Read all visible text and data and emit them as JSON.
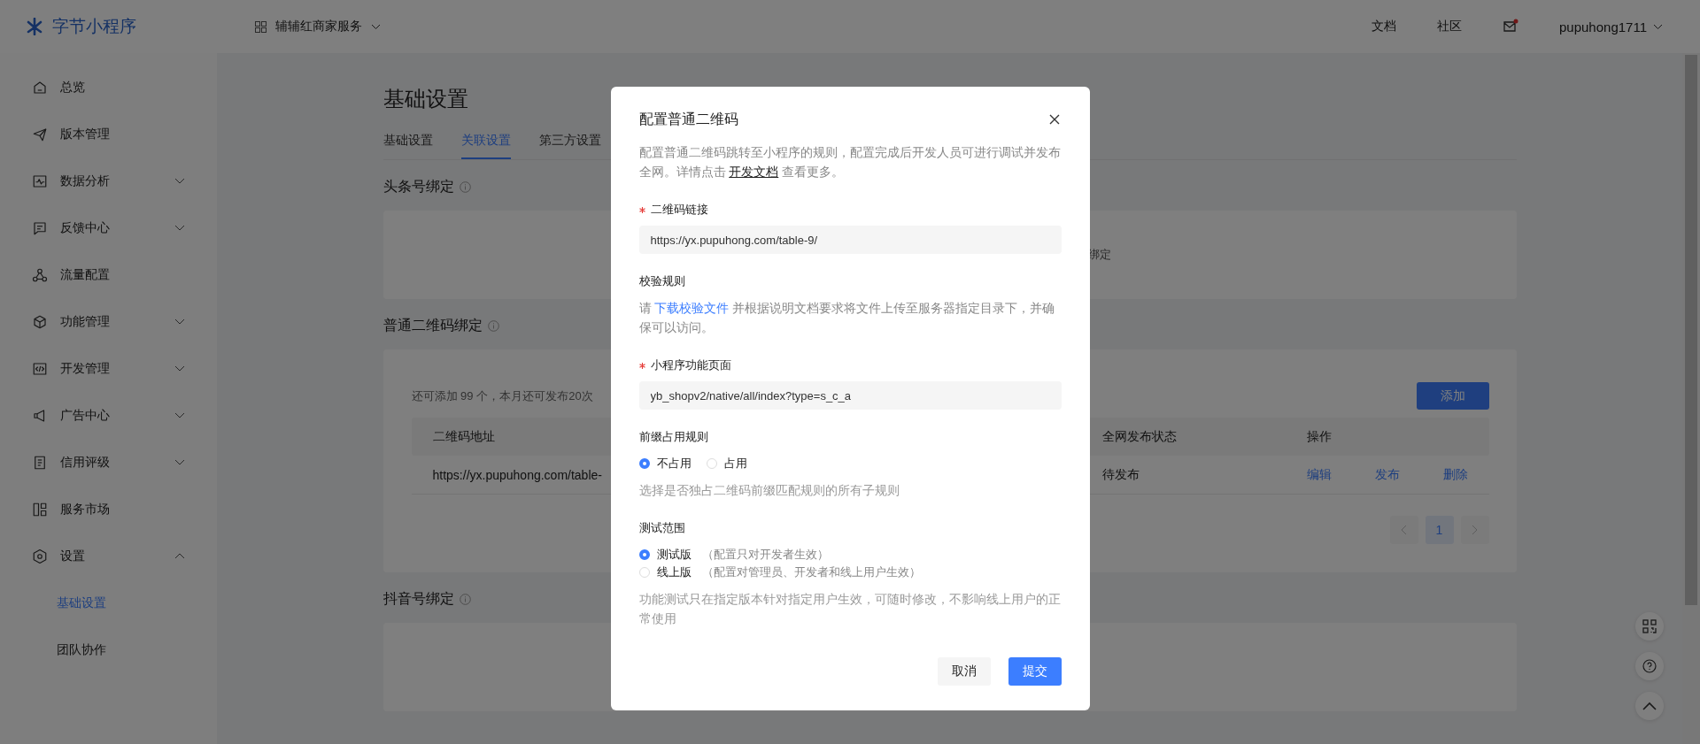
{
  "header": {
    "logo": "字节小程序",
    "project": "辅辅红商家服务",
    "links": [
      "文档",
      "社区"
    ],
    "has_unread": true,
    "user": "pupuhong1711"
  },
  "sidebar": {
    "items": [
      {
        "label": "总览",
        "kind": "link",
        "selected": false
      },
      {
        "label": "版本管理",
        "kind": "link",
        "selected": false
      },
      {
        "label": "数据分析",
        "kind": "group",
        "selected": false,
        "expanded": false
      },
      {
        "label": "反馈中心",
        "kind": "group",
        "selected": false,
        "expanded": false
      },
      {
        "label": "流量配置",
        "kind": "link",
        "selected": false
      },
      {
        "label": "功能管理",
        "kind": "group",
        "selected": false,
        "expanded": false
      },
      {
        "label": "开发管理",
        "kind": "group",
        "selected": false,
        "expanded": false
      },
      {
        "label": "广告中心",
        "kind": "group",
        "selected": false,
        "expanded": false
      },
      {
        "label": "信用评级",
        "kind": "group",
        "selected": false,
        "expanded": false
      },
      {
        "label": "服务市场",
        "kind": "link",
        "selected": false
      },
      {
        "label": "设置",
        "kind": "group",
        "selected": false,
        "expanded": true,
        "children": [
          {
            "label": "基础设置",
            "selected": true
          },
          {
            "label": "团队协作",
            "selected": false
          }
        ]
      }
    ]
  },
  "main": {
    "title": "基础设置",
    "tabs": [
      {
        "label": "基础设置",
        "selected": false
      },
      {
        "label": "关联设置",
        "selected": true
      },
      {
        "label": "第三方设置",
        "selected": false
      }
    ],
    "sections": [
      {
        "kind": "empty",
        "heading": "头条号绑定",
        "text": "绑定"
      },
      {
        "kind": "table",
        "heading": "普通二维码绑定",
        "quota": "还可添加 99 个，本月还可发布20次",
        "add_button": "添加",
        "table": {
          "columns": [
            "二维码地址",
            "全网发布状态",
            "操作"
          ],
          "rows": [
            {
              "cells": [
                "https://yx.pupuhong.com/table-",
                "待发布"
              ],
              "actions": [
                "编辑",
                "发布",
                "删除"
              ]
            }
          ]
        },
        "pagination": {
          "pages": [
            {
              "label": "1",
              "selected": true
            }
          ]
        }
      },
      {
        "kind": "empty",
        "heading": "抖音号绑定"
      }
    ]
  },
  "modal": {
    "title": "配置普通二维码",
    "description": {
      "before": "配置普通二维码跳转至小程序的规则，配置完成后开发人员可进行调试并发布全网。详情点击 ",
      "link": "开发文档",
      "after": " 查看更多。"
    },
    "fields": [
      {
        "kind": "input",
        "label": "二维码链接",
        "required": true,
        "value": "https://yx.pupuhong.com/table-9/"
      },
      {
        "kind": "note",
        "label": "校验规则",
        "required": false,
        "before": "请 ",
        "link": "下载校验文件",
        "after": " 并根据说明文档要求将文件上传至服务器指定目录下，并确保可以访问。"
      },
      {
        "kind": "input",
        "label": "小程序功能页面",
        "required": true,
        "value": "yb_shopv2/native/all/index?type=s_c_a"
      },
      {
        "kind": "radio",
        "label": "前缀占用规则",
        "required": false,
        "inline": true,
        "options": [
          {
            "label": "不占用",
            "selected": true
          },
          {
            "label": "占用",
            "selected": false
          }
        ],
        "help": "选择是否独占二维码前缀匹配规则的所有子规则"
      },
      {
        "kind": "radio",
        "label": "测试范围",
        "required": false,
        "inline": false,
        "options": [
          {
            "label": "测试版",
            "hint": "（配置只对开发者生效）",
            "selected": true
          },
          {
            "label": "线上版",
            "hint": "（配置对管理员、开发者和线上用户生效）",
            "selected": false
          }
        ],
        "help": "功能测试只在指定版本针对指定用户生效，可随时修改，不影响线上用户的正常使用"
      }
    ],
    "buttons": [
      {
        "label": "取消",
        "kind": "default"
      },
      {
        "label": "提交",
        "kind": "primary"
      }
    ]
  }
}
